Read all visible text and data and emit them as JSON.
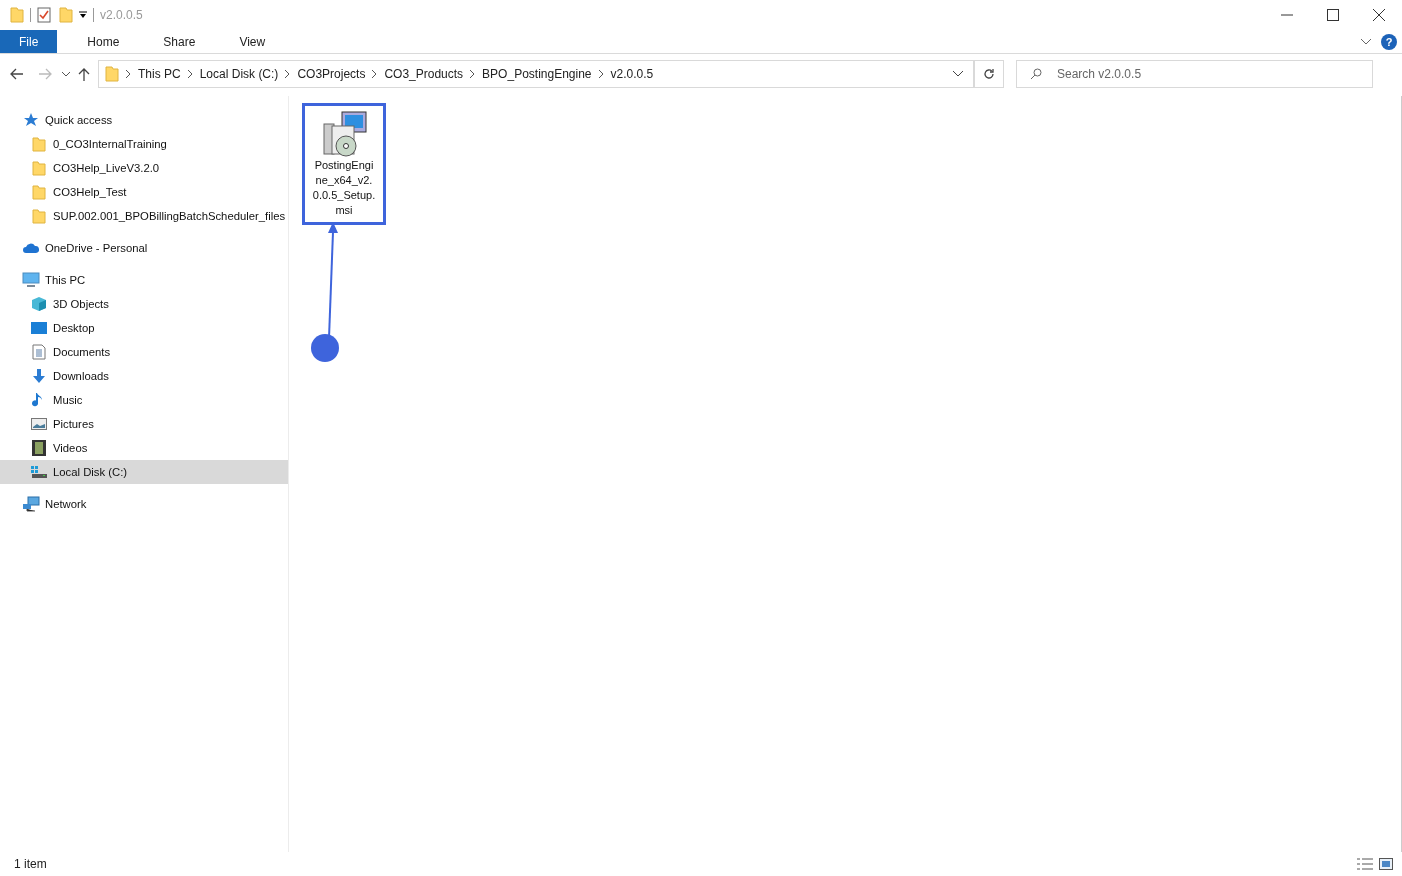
{
  "window": {
    "title": "v2.0.0.5"
  },
  "ribbon_tabs": [
    {
      "label": "File",
      "kind": "file"
    },
    {
      "label": "Home",
      "kind": "tab"
    },
    {
      "label": "Share",
      "kind": "tab"
    },
    {
      "label": "View",
      "kind": "tab"
    }
  ],
  "help_button": "?",
  "breadcrumbs": [
    "This PC",
    "Local Disk (C:)",
    "CO3Projects",
    "CO3_Products",
    "BPO_PostingEngine",
    "v2.0.0.5"
  ],
  "search": {
    "placeholder": "Search v2.0.0.5"
  },
  "sidebar": {
    "items": [
      {
        "label": "Quick access",
        "selected": false,
        "children": [
          {
            "label": "0_CO3InternalTraining",
            "selected": false
          },
          {
            "label": "CO3Help_LiveV3.2.0",
            "selected": false
          },
          {
            "label": "CO3Help_Test",
            "selected": false
          },
          {
            "label": "SUP.002.001_BPOBillingBatchScheduler_files",
            "selected": false
          }
        ]
      },
      {
        "label": "OneDrive - Personal",
        "selected": false
      },
      {
        "label": "This PC",
        "selected": false,
        "children": [
          {
            "label": "3D Objects",
            "selected": false
          },
          {
            "label": "Desktop",
            "selected": false
          },
          {
            "label": "Documents",
            "selected": false
          },
          {
            "label": "Downloads",
            "selected": false
          },
          {
            "label": "Music",
            "selected": false
          },
          {
            "label": "Pictures",
            "selected": false
          },
          {
            "label": "Videos",
            "selected": false
          },
          {
            "label": "Local Disk (C:)",
            "selected": true
          }
        ]
      },
      {
        "label": "Network",
        "selected": false
      }
    ]
  },
  "files": [
    {
      "name": "PostingEngine_x64_v2.0.0.5_Setup.msi",
      "highlighted": true
    }
  ],
  "status_bar": {
    "count": "1 item"
  }
}
